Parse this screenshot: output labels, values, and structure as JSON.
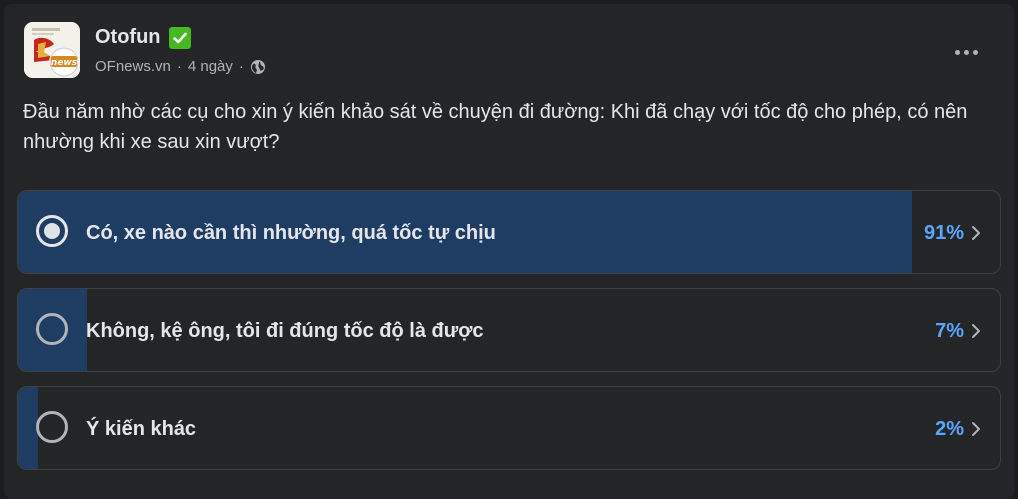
{
  "header": {
    "page_name": "Otofun",
    "verified_icon": "check-box-icon",
    "source": "OFnews.vn",
    "separator": "·",
    "time": "4 ngày",
    "time_separator": "·",
    "audience_icon": "globe-icon",
    "more_icon": "more-horizontal-icon",
    "avatar_text": "news"
  },
  "post": {
    "text": "Đầu năm nhờ các cụ cho xin ý kiến khảo sát về chuyện đi đường: Khi đã chạy với tốc độ cho phép, có nên nhường khi xe sau xin vượt?"
  },
  "poll": {
    "options": [
      {
        "label": "Có, xe nào cần thì nhường, quá tốc tự chịu",
        "percent_label": "91%",
        "percent": 91,
        "selected": true
      },
      {
        "label": "Không, kệ ông, tôi đi đúng tốc độ là được",
        "percent_label": "7%",
        "percent": 7,
        "selected": false
      },
      {
        "label": "Ý kiến khác",
        "percent_label": "2%",
        "percent": 2,
        "selected": false
      }
    ]
  },
  "colors": {
    "background": "#242526",
    "fill": "#1f3d63",
    "percent": "#5aa7ff",
    "verified": "#45b91f"
  }
}
